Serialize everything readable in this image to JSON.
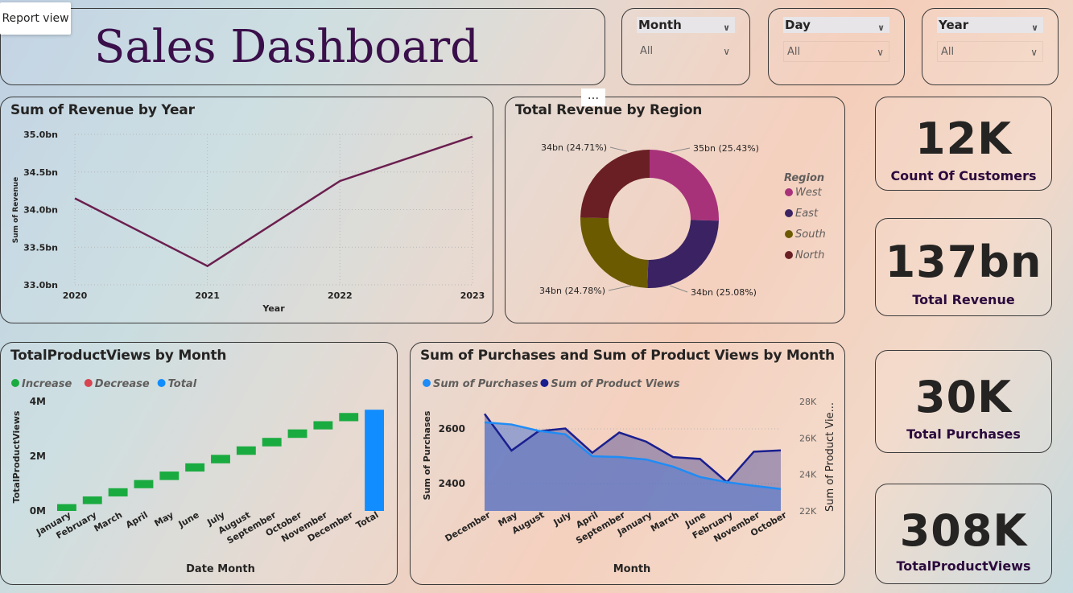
{
  "view_chip": "Report view",
  "dashboard_title": "Sales Dashboard",
  "more_options": "...",
  "slicers": [
    {
      "label": "Month",
      "value": "All"
    },
    {
      "label": "Day",
      "value": "All"
    },
    {
      "label": "Year",
      "value": "All"
    }
  ],
  "kpis": [
    {
      "value": "12K",
      "label": "Count Of Customers"
    },
    {
      "value": "137bn",
      "label": "Total Revenue"
    },
    {
      "value": "30K",
      "label": "Total Purchases"
    },
    {
      "value": "308K",
      "label": "TotalProductViews"
    }
  ],
  "colors": {
    "line_revenue": "#6b1f4f",
    "west": "#a8327a",
    "east": "#3b2363",
    "south": "#6b5a00",
    "north": "#6a1f24",
    "increase": "#1aab40",
    "total": "#118dff",
    "purchases": "#1f8cf5",
    "product_views": "#1a1f8f"
  },
  "chart_data": [
    {
      "type": "line",
      "title": "Sum of Revenue by Year",
      "xlabel": "Year",
      "ylabel": "Sum of Revenue",
      "x": [
        "2020",
        "2021",
        "2022",
        "2023"
      ],
      "values": [
        34.15,
        33.25,
        34.38,
        34.97
      ],
      "yticks": [
        "33.0bn",
        "33.5bn",
        "34.0bn",
        "34.5bn",
        "35.0bn"
      ],
      "ylim": [
        33.0,
        35.0
      ]
    },
    {
      "type": "pie",
      "title": "Total Revenue by Region",
      "legend_title": "Region",
      "slices": [
        {
          "name": "West",
          "value": 25.43,
          "label": "35bn (25.43%)"
        },
        {
          "name": "East",
          "value": 25.08,
          "label": "34bn (25.08%)"
        },
        {
          "name": "South",
          "value": 24.78,
          "label": "34bn (24.78%)"
        },
        {
          "name": "North",
          "value": 24.71,
          "label": "34bn (24.71%)"
        }
      ]
    },
    {
      "type": "bar",
      "title": "TotalProductViews by Month",
      "xlabel": "Date Month",
      "ylabel": "TotalProductViews",
      "legend": [
        "Increase",
        "Decrease",
        "Total"
      ],
      "categories": [
        "January",
        "February",
        "March",
        "April",
        "May",
        "June",
        "July",
        "August",
        "September",
        "October",
        "November",
        "December",
        "Total"
      ],
      "values": [
        0.25,
        0.28,
        0.3,
        0.3,
        0.31,
        0.3,
        0.31,
        0.31,
        0.31,
        0.31,
        0.3,
        0.3,
        3.7
      ],
      "yticks": [
        "0M",
        "2M",
        "4M"
      ],
      "ylim": [
        0,
        4
      ]
    },
    {
      "type": "area",
      "title": "Sum of Purchases and Sum of Product Views by Month",
      "xlabel": "Month",
      "ylabel": "Sum of Purchases",
      "y2label": "Sum of Product Vie...",
      "categories": [
        "December",
        "May",
        "August",
        "July",
        "April",
        "September",
        "January",
        "March",
        "June",
        "February",
        "November",
        "October"
      ],
      "series": [
        {
          "name": "Sum of Purchases",
          "values": [
            2624,
            2616,
            2593,
            2580,
            2500,
            2497,
            2488,
            2462,
            2424,
            2405,
            2392,
            2380
          ]
        },
        {
          "name": "Sum of Product Views",
          "values": [
            27320,
            25310,
            26370,
            26520,
            25190,
            26300,
            25800,
            24950,
            24850,
            23580,
            25250,
            25320
          ]
        }
      ],
      "yticks": [
        "2400",
        "2600"
      ],
      "ylim": [
        2300,
        2700
      ],
      "y2ticks": [
        "22K",
        "24K",
        "26K",
        "28K"
      ],
      "y2lim": [
        22000,
        28000
      ]
    }
  ]
}
